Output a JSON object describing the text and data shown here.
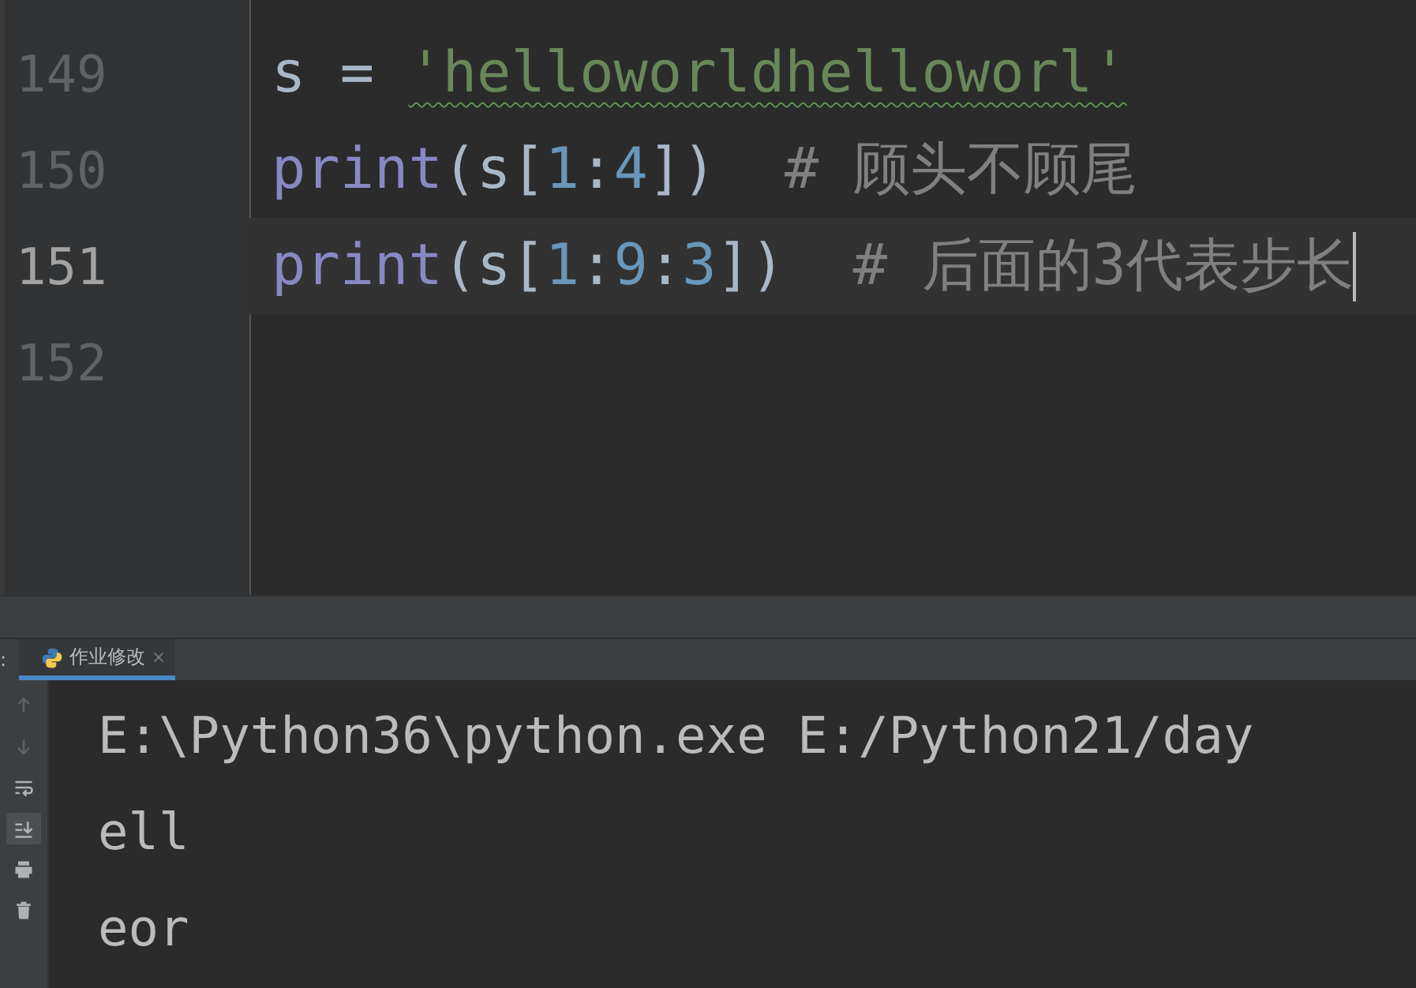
{
  "editor": {
    "lines": [
      {
        "number": "149",
        "current": false,
        "tokens": [
          {
            "kind": "plain",
            "text": "s = "
          },
          {
            "kind": "string",
            "text": "'helloworldhelloworl'",
            "warning": true
          }
        ]
      },
      {
        "number": "150",
        "current": false,
        "tokens": [
          {
            "kind": "builtin",
            "text": "print"
          },
          {
            "kind": "paren",
            "text": "(s"
          },
          {
            "kind": "bracket",
            "text": "["
          },
          {
            "kind": "number",
            "text": "1"
          },
          {
            "kind": "plain",
            "text": ":"
          },
          {
            "kind": "number",
            "text": "4"
          },
          {
            "kind": "bracket",
            "text": "]"
          },
          {
            "kind": "paren",
            "text": ")"
          },
          {
            "kind": "comment",
            "text": "# 顾头不顾尾"
          }
        ]
      },
      {
        "number": "151",
        "current": true,
        "tokens": [
          {
            "kind": "builtin",
            "text": "print"
          },
          {
            "kind": "paren",
            "text": "(s"
          },
          {
            "kind": "bracket",
            "text": "["
          },
          {
            "kind": "number",
            "text": "1"
          },
          {
            "kind": "plain",
            "text": ":"
          },
          {
            "kind": "number",
            "text": "9"
          },
          {
            "kind": "plain",
            "text": ":"
          },
          {
            "kind": "number",
            "text": "3"
          },
          {
            "kind": "bracket",
            "text": "]"
          },
          {
            "kind": "paren",
            "text": ")"
          },
          {
            "kind": "comment",
            "text": "# 后面的3代表步长"
          }
        ]
      },
      {
        "number": "152",
        "current": false
      }
    ]
  },
  "run_panel": {
    "label": ":",
    "tab": {
      "title": "作业修改",
      "selected": true
    },
    "tools": [
      {
        "kind": "up",
        "disabled": true,
        "selected": false
      },
      {
        "kind": "down",
        "disabled": true,
        "selected": false
      },
      {
        "kind": "wrap",
        "disabled": false,
        "selected": false
      },
      {
        "kind": "scroll-end",
        "disabled": false,
        "selected": true
      },
      {
        "kind": "print",
        "disabled": false,
        "selected": false
      },
      {
        "kind": "trash",
        "disabled": false,
        "selected": false
      }
    ],
    "output": [
      "E:\\Python36\\python.exe E:/Python21/day",
      "ell",
      "eor"
    ]
  }
}
